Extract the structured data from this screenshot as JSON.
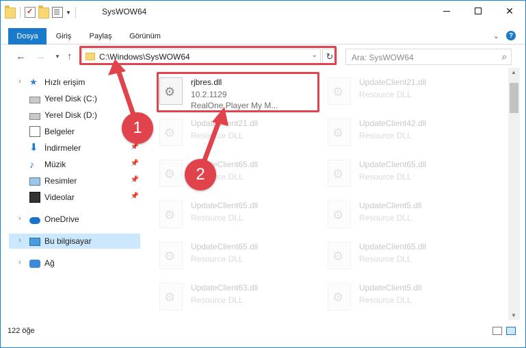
{
  "window": {
    "title": "SysWOW64",
    "controls": {
      "minimize": "",
      "maximize": "",
      "close": "✕"
    }
  },
  "ribbon": {
    "tabs": [
      "Dosya",
      "Giriş",
      "Paylaş",
      "Görünüm"
    ],
    "help": "?",
    "collapse": "⌄"
  },
  "nav": {
    "back": "←",
    "forward": "→",
    "recent": "⌄",
    "up": "↑",
    "address": "C:\\Windows\\SysWOW64",
    "address_dropdown": "⌄",
    "refresh": "↻",
    "search_placeholder": "Ara: SysWOW64",
    "search_icon": "⌕"
  },
  "sidebar": {
    "items": [
      {
        "label": "Hızlı erişim",
        "icon": "star-icon"
      },
      {
        "label": "Yerel Disk (C:)",
        "icon": "disk-icon"
      },
      {
        "label": "Yerel Disk (D:)",
        "icon": "disk-icon"
      },
      {
        "label": "Belgeler",
        "icon": "document-icon"
      },
      {
        "label": "İndirmeler",
        "icon": "download-icon"
      },
      {
        "label": "Müzik",
        "icon": "music-icon"
      },
      {
        "label": "Resimler",
        "icon": "picture-icon"
      },
      {
        "label": "Videolar",
        "icon": "video-icon"
      },
      {
        "label": "OneDrive",
        "icon": "cloud-icon"
      },
      {
        "label": "Bu bilgisayar",
        "icon": "computer-icon"
      },
      {
        "label": "Ağ",
        "icon": "network-icon"
      }
    ],
    "pin": "📌"
  },
  "files": {
    "highlighted": {
      "name": "rjbres.dll",
      "version": "10.2.1129",
      "description": "RealOne Player My M..."
    },
    "left_column": [
      {
        "name": "UpdateClient21.dll",
        "type": "Resource DLL"
      },
      {
        "name": "UpdateClient65.dll",
        "type": "Resource DLL"
      },
      {
        "name": "UpdateClient65.dll",
        "type": "Resource DLL"
      },
      {
        "name": "UpdateClient65.dll",
        "type": "Resource DLL"
      },
      {
        "name": "UpdateClient63.dll",
        "type": "Resource DLL"
      }
    ],
    "right_column": [
      {
        "name": "UpdateClient21.dll",
        "type": "Resource DLL"
      },
      {
        "name": "UpdateClient42.dll",
        "type": "Resource DLL"
      },
      {
        "name": "UpdateClient65.dll",
        "type": "Resource DLL"
      },
      {
        "name": "UpdateClient5.dll",
        "type": "Resource DLL"
      },
      {
        "name": "UpdateClient65.dll",
        "type": "Resource DLL"
      },
      {
        "name": "UpdateClient5.dll",
        "type": "Resource DLL"
      }
    ]
  },
  "status": {
    "item_count": "122 öğe"
  },
  "annotations": {
    "step1": "1",
    "step2": "2",
    "color": "#e0434b"
  }
}
